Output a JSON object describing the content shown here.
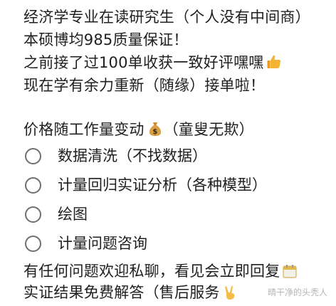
{
  "post": {
    "intro_lines": [
      "经济学专业在读研究生（个人没有中间商）",
      "本硕博均985质量保证！",
      "之前接了过100单收获一致好评嘿嘿",
      "现在学有余力重新（随缘）接单啦！"
    ],
    "intro_emoji": "thumbs-up-icon",
    "price_line": "价格随工作量变动",
    "price_suffix": "（童叟无欺）",
    "price_emoji": "money-bag-icon",
    "options": [
      "数据清洗（不找数据）",
      "计量回归实证分析（各种模型）",
      "绘图",
      "计量问题咨询"
    ],
    "closing_lines": [
      "有任何问题欢迎私聊，看见会立即回复",
      "实证结果免费解答（售后服务"
    ],
    "closing_emoji_1": "calendar-icon",
    "closing_emoji_2": "victory-hand-icon",
    "watermark": "晴干净的头秃人"
  }
}
